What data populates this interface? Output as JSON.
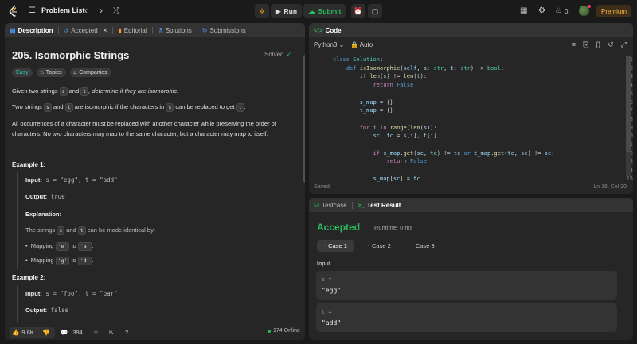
{
  "colors": {
    "accent_green": "#2cbb5d",
    "accent_orange": "#ffa116",
    "premium_text": "#ffb84d",
    "easy_tag": "#2cc3b3"
  },
  "topbar": {
    "problem_list": "Problem List",
    "run": "Run",
    "submit": "Submit",
    "streak": "0",
    "premium": "Premium"
  },
  "left": {
    "tabs": [
      "Description",
      "Accepted",
      "Editorial",
      "Solutions",
      "Submissions"
    ],
    "title": "205. Isomorphic Strings",
    "solved": "Solved",
    "tags": [
      "Easy",
      "Topics",
      "Companies"
    ],
    "p1_pre": "Given two strings",
    "p1_s": "s",
    "p1_and": "and",
    "p1_t": "t",
    "p1_em": ", determine if they are isomorphic.",
    "p2_a": "Two strings",
    "p2_s": "s",
    "p2_and": "and",
    "p2_t": "t",
    "p2_mid": "are isomorphic if the characters in",
    "p2_s2": "s",
    "p2_end": "can be replaced to get",
    "p2_t2": "t",
    "p2_dot": ".",
    "p3_l1": "All occurrences of a character must be replaced with another character while preserving the order of",
    "p3_l2": "characters. No two characters may map to the same character, but a character may map to itself.",
    "ex1": {
      "heading": "Example 1:",
      "input_label": "Input:",
      "input": " s = \"egg\", t = \"add\"",
      "output_label": "Output:",
      "output": " true",
      "expl_label": "Explanation:",
      "expl_text_a": "The strings",
      "expl_s": "s",
      "expl_and": "and",
      "expl_t": "t",
      "expl_text_b": "can be made identical by:",
      "m1_a": "Mapping",
      "m1_from": "'e'",
      "m1_to_w": "to",
      "m1_to": "'a'",
      "m2_a": "Mapping",
      "m2_from": "'g'",
      "m2_to_w": "to",
      "m2_to": "'d'"
    },
    "ex2": {
      "heading": "Example 2:",
      "input_label": "Input:",
      "input": " s = \"foo\", t = \"bar\"",
      "output_label": "Output:",
      "output": " false"
    },
    "bottom": {
      "likes": "9.6K",
      "comments": "394",
      "online": "174 Online"
    }
  },
  "code": {
    "tab": "Code",
    "lang": "Python3",
    "auto": "Auto",
    "lines": [
      "1",
      "2",
      "3",
      "4",
      "5",
      "6",
      "7",
      "8",
      "9",
      "10",
      "11",
      "12",
      "13",
      "14",
      "15"
    ],
    "saved": "Saved",
    "cursor": "Ln 16, Col 20"
  },
  "test": {
    "tabs": [
      "Testcase",
      "Test Result"
    ],
    "status": "Accepted",
    "runtime": "Runtime: 0 ms",
    "cases": [
      "Case 1",
      "Case 2",
      "Case 3"
    ],
    "input_heading": "Input",
    "inputs": [
      {
        "label": "s =",
        "value": "\"egg\""
      },
      {
        "label": "t =",
        "value": "\"add\""
      }
    ]
  }
}
